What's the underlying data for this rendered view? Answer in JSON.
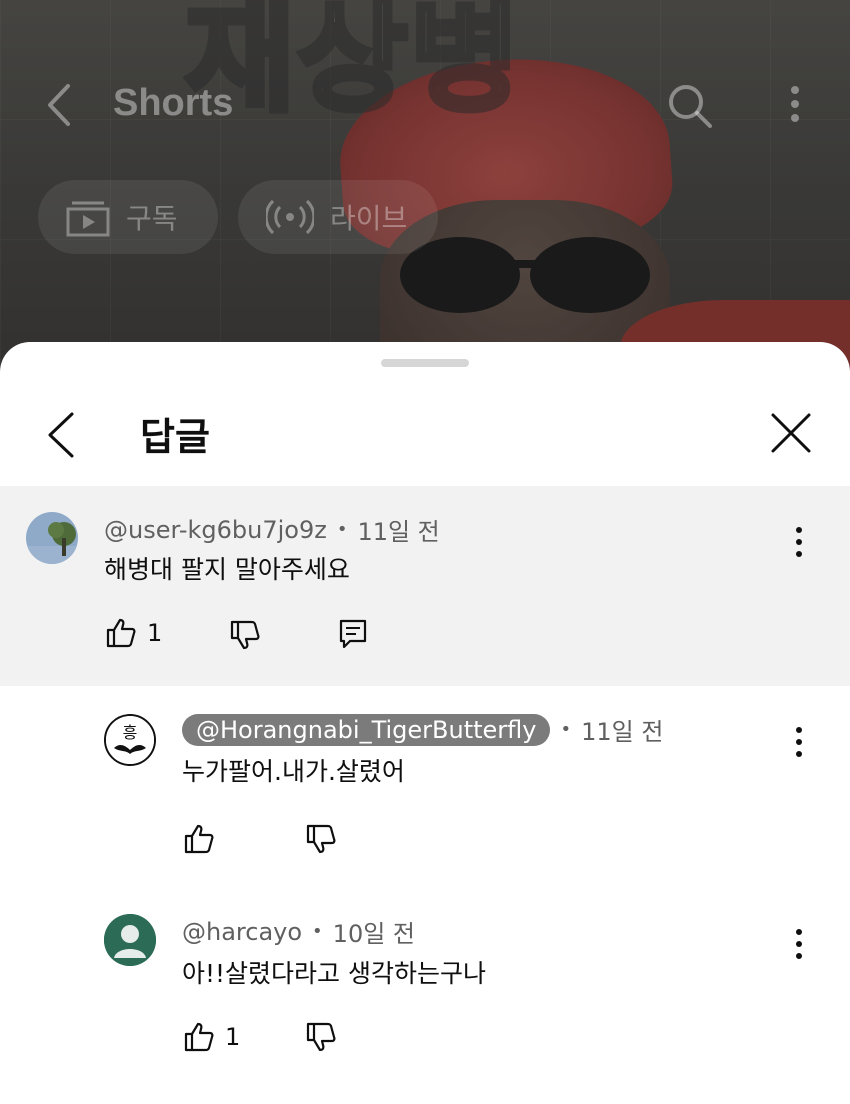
{
  "video": {
    "overlay_title": "재상병"
  },
  "top_bar": {
    "title": "Shorts",
    "icons": [
      "back-arrow-icon",
      "search-icon",
      "more-vert-icon"
    ]
  },
  "chips": [
    {
      "label": "구독",
      "icon": "subscriptions-icon"
    },
    {
      "label": "라이브",
      "icon": "live-icon"
    }
  ],
  "sheet": {
    "title": "답글"
  },
  "comments": [
    {
      "handle": "@user-kg6bu7jo9z",
      "time": "11일 전",
      "text": "해병대 팔지 말아주세요",
      "likes": "1"
    },
    {
      "handle": "@Horangnabi_TigerButterfly",
      "time": "11일 전",
      "text": "누가팔어.내가.살렸어",
      "likes": ""
    },
    {
      "handle": "@harcayo",
      "time": "10일 전",
      "text": "아!!살렸다라고 생각하는구나",
      "likes": "1"
    }
  ],
  "colors": {
    "parent_bg": "#f2f2f2",
    "pill_bg": "#7b7b7b",
    "harcayo_avatar": "#2c6b55"
  }
}
